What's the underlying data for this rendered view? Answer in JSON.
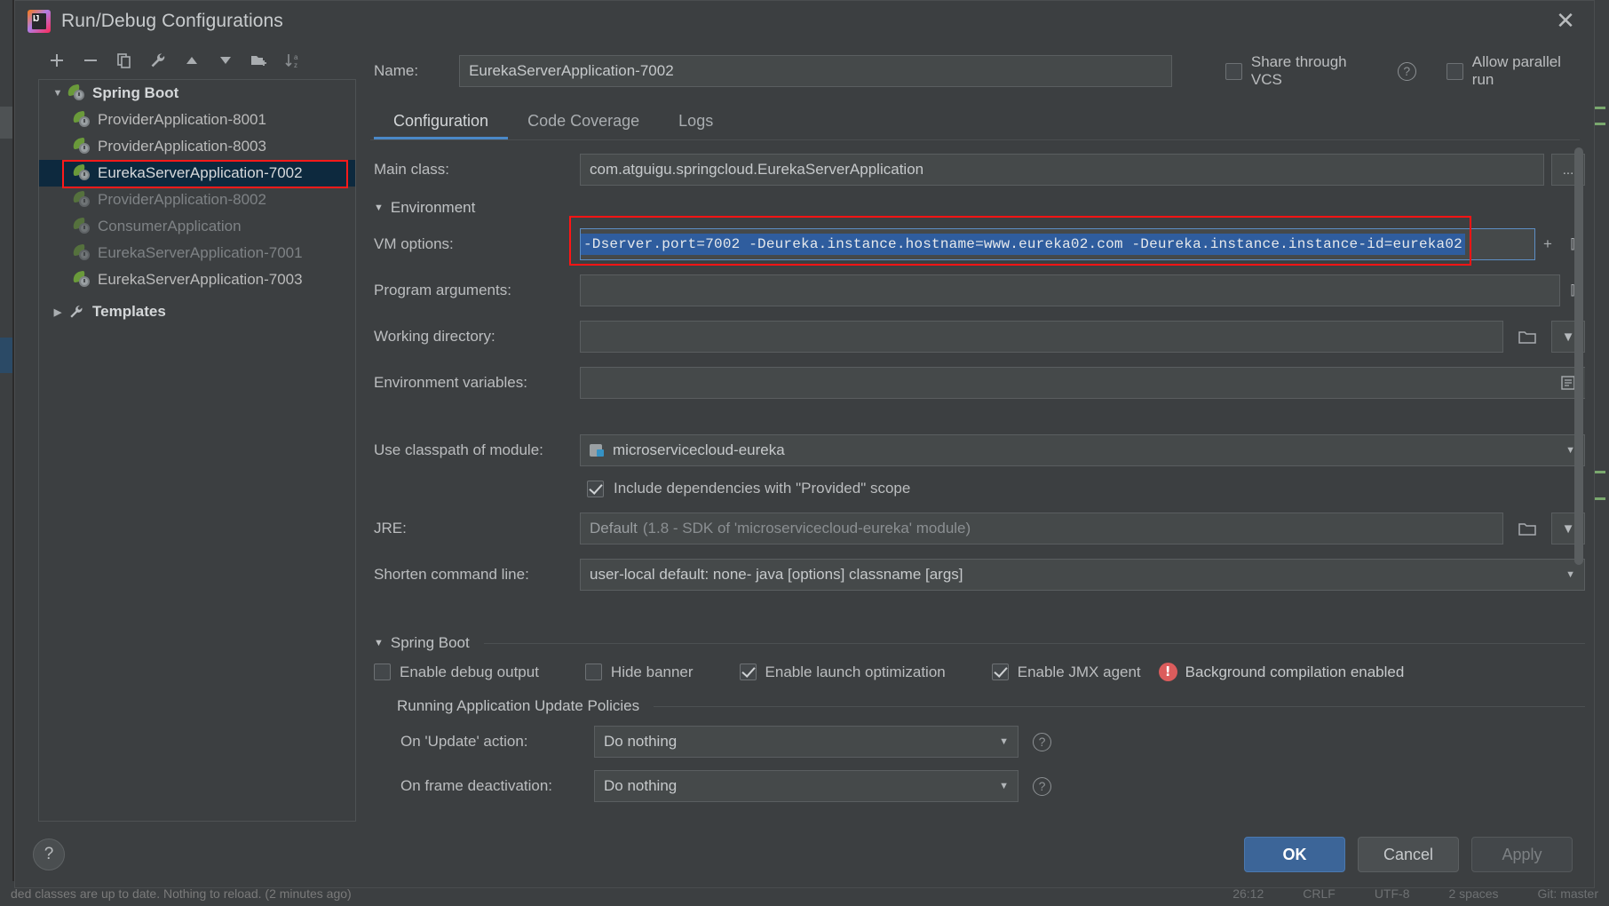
{
  "window": {
    "title": "Run/Debug Configurations",
    "logo_icon": "intellij-idea-logo",
    "close_icon": "close-icon"
  },
  "toolbar": {
    "buttons": [
      {
        "name": "add-configuration-button",
        "icon": "plus-icon",
        "title": "Add New Configuration"
      },
      {
        "name": "remove-configuration-button",
        "icon": "minus-icon",
        "title": "Remove Configuration"
      },
      {
        "name": "copy-configuration-button",
        "icon": "copy-icon",
        "title": "Copy Configuration"
      },
      {
        "name": "edit-templates-button",
        "icon": "wrench-icon",
        "title": "Edit Templates"
      },
      {
        "name": "move-up-button",
        "icon": "arrow-up-icon",
        "title": "Move Up"
      },
      {
        "name": "move-down-button",
        "icon": "arrow-down-icon",
        "title": "Move Down"
      },
      {
        "name": "new-folder-button",
        "icon": "folder-plus-icon",
        "title": "Create New Folder"
      },
      {
        "name": "sort-button",
        "icon": "sort-alphabetical-icon",
        "title": "Sort Configurations"
      }
    ]
  },
  "tree": {
    "group_label": "Spring Boot",
    "group_icon": "spring-boot-icon",
    "items": [
      {
        "label": "ProviderApplication-8001",
        "dim": false,
        "selected": false
      },
      {
        "label": "ProviderApplication-8003",
        "dim": false,
        "selected": false
      },
      {
        "label": "EurekaServerApplication-7002",
        "dim": false,
        "selected": true
      },
      {
        "label": "ProviderApplication-8002",
        "dim": true,
        "selected": false
      },
      {
        "label": "ConsumerApplication",
        "dim": true,
        "selected": false
      },
      {
        "label": "EurekaServerApplication-7001",
        "dim": true,
        "selected": false
      },
      {
        "label": "EurekaServerApplication-7003",
        "dim": false,
        "selected": false
      }
    ],
    "templates_label": "Templates",
    "templates_icon": "wrench-icon"
  },
  "header": {
    "name_label": "Name:",
    "name_value": "EurekaServerApplication-7002",
    "share_vcs_label": "Share through VCS",
    "share_vcs_checked": false,
    "share_vcs_help_icon": "help-icon",
    "allow_parallel_label": "Allow parallel run",
    "allow_parallel_checked": false
  },
  "tabs": [
    {
      "label": "Configuration",
      "active": true
    },
    {
      "label": "Code Coverage",
      "active": false
    },
    {
      "label": "Logs",
      "active": false
    }
  ],
  "form": {
    "main_class_label": "Main class:",
    "main_class_value": "com.atguigu.springcloud.EurekaServerApplication",
    "main_class_browse": "...",
    "environment_section": "Environment",
    "vm_options_label": "VM options:",
    "vm_options_value": "-Dserver.port=7002 -Deureka.instance.hostname=www.eureka02.com -Deureka.instance.instance-id=eureka02",
    "vm_options_macro_icon": "plus-icon",
    "vm_options_expand_icon": "expand-icon",
    "program_arguments_label": "Program arguments:",
    "program_arguments_value": "",
    "program_arguments_expand_icon": "expand-icon",
    "working_directory_label": "Working directory:",
    "working_directory_value": "",
    "working_directory_browse_icon": "folder-icon",
    "working_directory_dropdown_icon": "chevron-down-icon",
    "environment_variables_label": "Environment variables:",
    "environment_variables_value": "",
    "environment_variables_edit_icon": "list-icon",
    "classpath_label": "Use classpath of module:",
    "classpath_value": "microservicecloud-eureka",
    "classpath_module_icon": "module-icon",
    "include_provided_label": "Include dependencies with \"Provided\" scope",
    "include_provided_checked": true,
    "jre_label": "JRE:",
    "jre_value": "Default",
    "jre_value_muted": "(1.8 - SDK of 'microservicecloud-eureka' module)",
    "jre_browse_icon": "folder-icon",
    "jre_dropdown_icon": "chevron-down-icon",
    "shorten_label": "Shorten command line:",
    "shorten_value": "user-local default: none",
    "shorten_value_muted": "- java [options] classname [args]",
    "shorten_dropdown_icon": "chevron-down-icon"
  },
  "spring_boot": {
    "section_label": "Spring Boot",
    "checks": [
      {
        "label": "Enable debug output",
        "checked": false,
        "name": "enable-debug-output-checkbox"
      },
      {
        "label": "Hide banner",
        "checked": false,
        "name": "hide-banner-checkbox"
      },
      {
        "label": "Enable launch optimization",
        "checked": true,
        "name": "enable-launch-optimization-checkbox"
      },
      {
        "label": "Enable JMX agent",
        "checked": true,
        "name": "enable-jmx-agent-checkbox"
      }
    ],
    "warning_icon": "error-icon",
    "warning_text": "Background compilation enabled"
  },
  "update_policies": {
    "section_label": "Running Application Update Policies",
    "on_update_label": "On 'Update' action:",
    "on_update_value": "Do nothing",
    "on_update_help_icon": "help-icon",
    "on_frame_label": "On frame deactivation:",
    "on_frame_value": "Do nothing",
    "on_frame_help_icon": "help-icon"
  },
  "footer": {
    "help_icon": "help-icon",
    "ok_label": "OK",
    "cancel_label": "Cancel",
    "apply_label": "Apply",
    "apply_disabled": true
  },
  "ide_status_bar": {
    "message": "ded classes are up to date. Nothing to reload. (2 minutes ago)",
    "right_items": [
      "26:12",
      "CRLF",
      "UTF-8",
      "2 spaces",
      "Git: master"
    ]
  },
  "colors": {
    "accent": "#3c6598",
    "selection": "#2f5d9e",
    "highlight_box": "#ff1414",
    "panel": "#3c3f41",
    "field": "#45494a",
    "text": "#bbbdbf"
  }
}
